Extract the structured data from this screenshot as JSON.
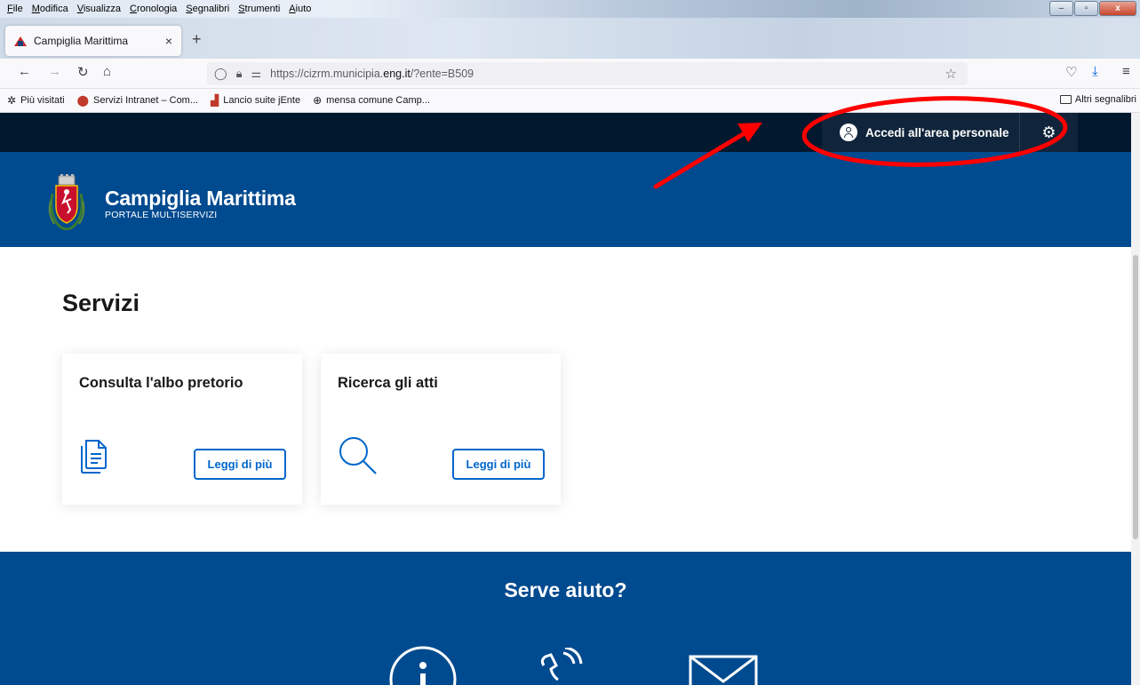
{
  "browser": {
    "menu": [
      "File",
      "Modifica",
      "Visualizza",
      "Cronologia",
      "Segnalibri",
      "Strumenti",
      "Aiuto"
    ],
    "tab_title": "Campiglia Marittima",
    "tab_close": "×",
    "new_tab": "+",
    "url_prefix": "https://cizrm.municipia.",
    "url_host": "eng.it",
    "url_suffix": "/?ente=B509",
    "bookmarks": [
      "Più visitati",
      "Servizi Intranet – Com...",
      "Lancio suite jEnte",
      "mensa comune Camp..."
    ],
    "other_bookmarks": "Altri segnalibri",
    "window_buttons": {
      "minimize": "–",
      "maximize": "▫",
      "close": "x"
    }
  },
  "topbar": {
    "login_label": "Accedi all'area personale"
  },
  "header": {
    "title": "Campiglia Marittima",
    "subtitle": "PORTALE MULTISERVIZI"
  },
  "services": {
    "title": "Servizi",
    "cards": [
      {
        "title": "Consulta l'albo pretorio",
        "button": "Leggi di più",
        "icon": "document-icon"
      },
      {
        "title": "Ricerca gli atti",
        "button": "Leggi di più",
        "icon": "search-icon"
      }
    ]
  },
  "help": {
    "title": "Serve aiuto?",
    "icons": [
      "info-icon",
      "phone-icon",
      "mail-icon"
    ]
  },
  "colors": {
    "primary": "#004a8f",
    "dark_strip": "#01182e",
    "accent": "#0066cc",
    "annotation": "#ff0000"
  }
}
